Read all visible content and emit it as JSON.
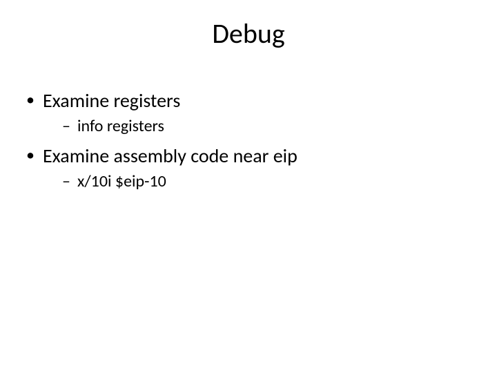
{
  "title": "Debug",
  "bullets": [
    {
      "text": "Examine registers",
      "sub": [
        "info registers"
      ]
    },
    {
      "text": "Examine assembly code near eip",
      "sub": [
        "x/10i $eip-10"
      ]
    }
  ]
}
